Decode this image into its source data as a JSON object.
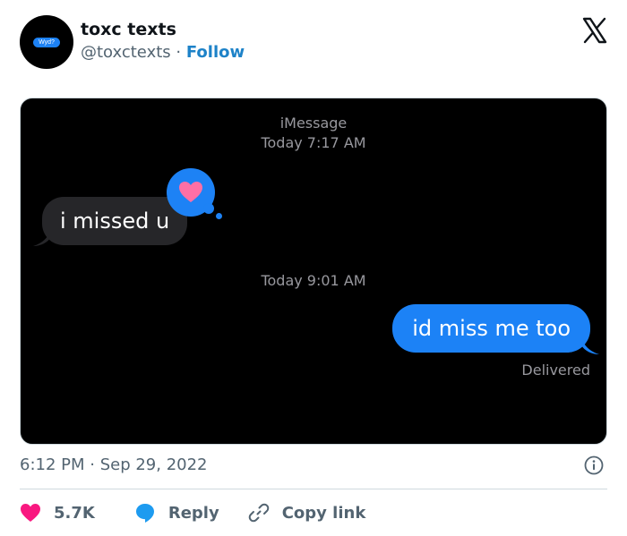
{
  "author": {
    "name": "toxc texts",
    "handle": "@toxctexts",
    "separator": "·",
    "follow_label": "Follow",
    "avatar_text": "Wyd?"
  },
  "screenshot": {
    "service": "iMessage",
    "first_time": "Today 7:17 AM",
    "incoming_message": "i missed u",
    "second_time": "Today 9:01 AM",
    "outgoing_message": "id miss me too",
    "status": "Delivered",
    "tapback": "heart-icon"
  },
  "meta": {
    "timestamp": "6:12 PM · Sep 29, 2022"
  },
  "actions": {
    "likes": "5.7K",
    "reply_label": "Reply",
    "copy_link_label": "Copy link"
  },
  "colors": {
    "like": "#f91880",
    "reply": "#1d9bf0",
    "follow": "#1d82c8",
    "imessage_blue": "#1c82f6",
    "tapback_heart": "#ff6fa5"
  }
}
